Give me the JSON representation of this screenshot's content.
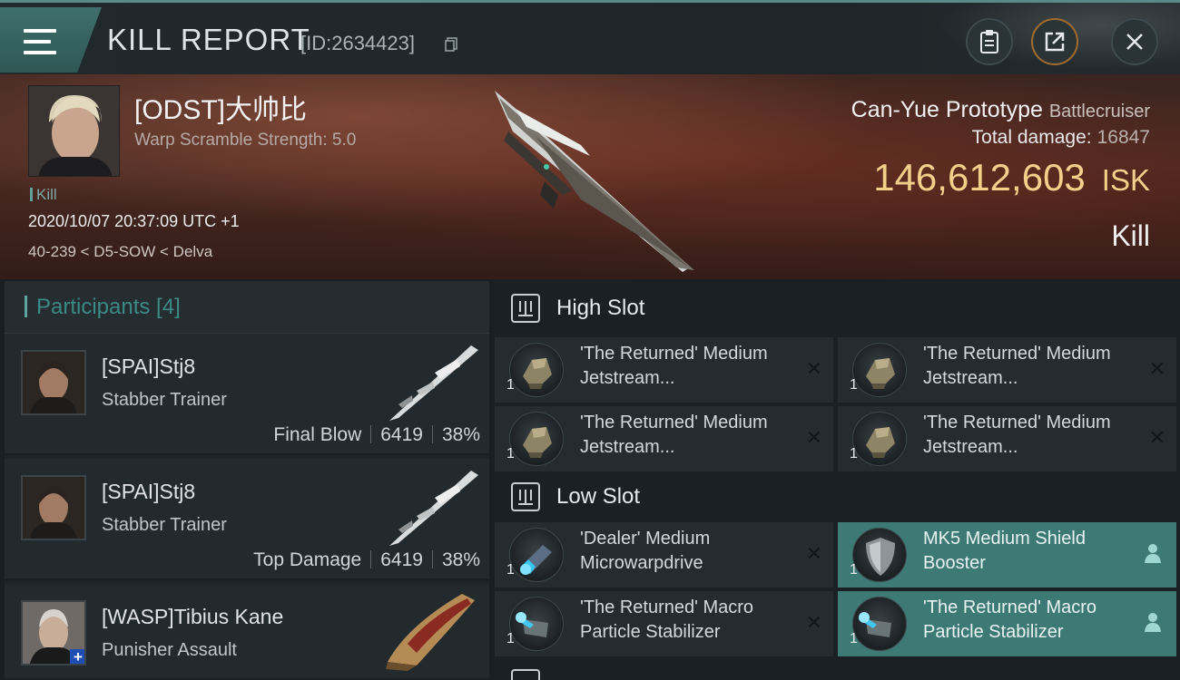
{
  "header": {
    "title": "KILL REPORT",
    "report_id": "[ID:2634423]",
    "icons": [
      "menu-icon",
      "clipboard-icon",
      "share-icon",
      "close-icon"
    ]
  },
  "victim": {
    "name": "[ODST]大帅比",
    "warp_scramble": "Warp Scramble Strength: 5.0",
    "tag": "Kill",
    "datetime": "2020/10/07 20:37:09 UTC +1",
    "location": "40-239 < D5-SOW < Delva",
    "ship_name": "Can-Yue Prototype",
    "ship_class": "Battlecruiser",
    "total_damage_label": "Total damage:",
    "total_damage": "16847",
    "isk_value": "146,612,603",
    "isk_unit": "ISK",
    "result": "Kill"
  },
  "participants": {
    "title": "Participants [4]",
    "items": [
      {
        "name": "[SPAI]Stj8",
        "ship": "Stabber Trainer",
        "role": "Final Blow",
        "damage": "6419",
        "percent": "38%"
      },
      {
        "name": "[SPAI]Stj8",
        "ship": "Stabber Trainer",
        "role": "Top Damage",
        "damage": "6419",
        "percent": "38%"
      },
      {
        "name": "[WASP]Tibius Kane",
        "ship": "Punisher Assault",
        "role": "",
        "damage": "",
        "percent": ""
      }
    ]
  },
  "slots": {
    "high": {
      "title": "High Slot",
      "modules": [
        {
          "name": "'The Returned' Medium Jetstream...",
          "qty": "1",
          "state": "destroyed"
        },
        {
          "name": "'The Returned' Medium Jetstream...",
          "qty": "1",
          "state": "destroyed"
        },
        {
          "name": "'The Returned' Medium Jetstream...",
          "qty": "1",
          "state": "destroyed"
        },
        {
          "name": "'The Returned' Medium Jetstream...",
          "qty": "1",
          "state": "destroyed"
        }
      ]
    },
    "low": {
      "title": "Low Slot",
      "modules": [
        {
          "name": "'Dealer' Medium Microwarpdrive",
          "qty": "1",
          "state": "destroyed"
        },
        {
          "name": "MK5 Medium Shield Booster",
          "qty": "1",
          "state": "dropped"
        },
        {
          "name": "'The Returned' Macro Particle Stabilizer",
          "qty": "1",
          "state": "destroyed"
        },
        {
          "name": "'The Returned' Macro Particle Stabilizer",
          "qty": "1",
          "state": "dropped"
        }
      ]
    }
  },
  "colors": {
    "accent": "#3d7a76",
    "isk": "#f3d08a",
    "participants_title": "#3c8a85"
  }
}
